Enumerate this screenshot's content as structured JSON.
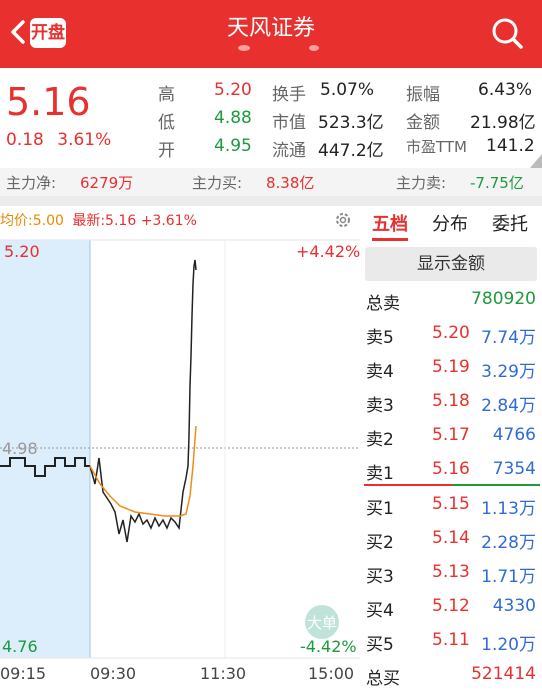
{
  "header": {
    "open_badge": "开盘",
    "title": "天风证券"
  },
  "quote": {
    "price": "5.16",
    "change": "0.18",
    "change_pct": "3.61%",
    "high_label": "高",
    "high": "5.20",
    "low_label": "低",
    "low": "4.88",
    "open_label": "开",
    "open": "4.95",
    "turnover_label": "换手",
    "turnover": "5.07%",
    "mktcap_label": "市值",
    "mktcap": "523.3亿",
    "float_label": "流通",
    "float": "447.2亿",
    "amplitude_label": "振幅",
    "amplitude": "6.43%",
    "amount_label": "金额",
    "amount": "21.98亿",
    "pe_label": "市盈TTM",
    "pe": "141.2"
  },
  "flow": {
    "net_label": "主力净:",
    "net": "6279万",
    "buy_label": "主力买:",
    "buy": "8.38亿",
    "sell_label": "主力卖:",
    "sell": "-7.75亿"
  },
  "chart": {
    "avg_label": "均价:5.00",
    "latest_label": "最新:5.16",
    "latest_pct": "+3.61%",
    "top_price": "5.20",
    "top_pct": "+4.42%",
    "mid_price": "4.98",
    "bottom_price": "4.76",
    "bottom_pct": "-4.42%",
    "big_order": "大单",
    "times": [
      "09:15",
      "09:30",
      "11:30",
      "15:00"
    ]
  },
  "tabs": [
    "五档",
    "分布",
    "委托"
  ],
  "show_amount": "显示金额",
  "orderbook": {
    "total_sell_label": "总卖",
    "total_sell": "780920",
    "asks": [
      {
        "name": "卖5",
        "price": "5.20",
        "vol": "7.74万"
      },
      {
        "name": "卖4",
        "price": "5.19",
        "vol": "3.29万"
      },
      {
        "name": "卖3",
        "price": "5.18",
        "vol": "2.84万"
      },
      {
        "name": "卖2",
        "price": "5.17",
        "vol": "4766"
      },
      {
        "name": "卖1",
        "price": "5.16",
        "vol": "7354"
      }
    ],
    "bids": [
      {
        "name": "买1",
        "price": "5.15",
        "vol": "1.13万"
      },
      {
        "name": "买2",
        "price": "5.14",
        "vol": "2.28万"
      },
      {
        "name": "买3",
        "price": "5.13",
        "vol": "1.71万"
      },
      {
        "name": "买4",
        "price": "5.12",
        "vol": "4330"
      },
      {
        "name": "买5",
        "price": "5.11",
        "vol": "1.20万"
      }
    ],
    "total_buy_label": "总买",
    "total_buy": "521414"
  },
  "colors": {
    "accent": "#e8302f",
    "up": "#e8302f",
    "down": "#1c9a3c",
    "vol": "#2f6bd8"
  }
}
